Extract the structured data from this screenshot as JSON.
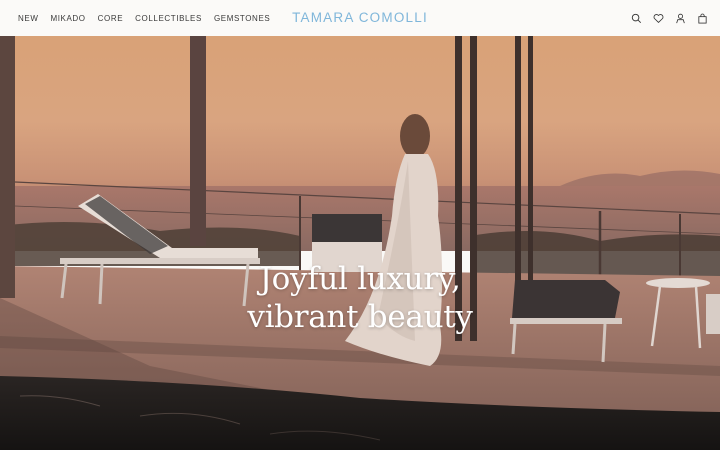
{
  "nav": {
    "items": [
      "NEW",
      "MIKADO",
      "CORE",
      "COLLECTIBLES",
      "GEMSTONES"
    ]
  },
  "brand": {
    "name": "TAMARA COMOLLI",
    "color": "#7fb6da"
  },
  "header_icons": [
    "search-icon",
    "heart-icon",
    "account-icon",
    "bag-icon"
  ],
  "hero": {
    "headline_line1": "Joyful luxury,",
    "headline_line2": "vibrant beauty"
  }
}
